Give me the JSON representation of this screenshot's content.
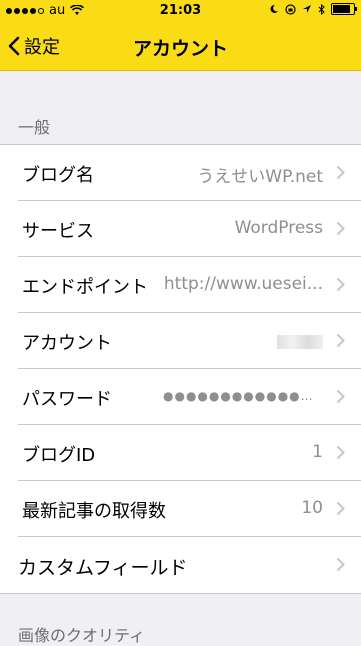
{
  "status": {
    "carrier": "au",
    "time": "21:03"
  },
  "nav": {
    "back_label": "設定",
    "title": "アカウント"
  },
  "section_general": "一般",
  "rows": [
    {
      "label": "ブログ名",
      "value": "うえせいWP.net"
    },
    {
      "label": "サービス",
      "value": "WordPress"
    },
    {
      "label": "エンドポイント",
      "value": "http://www.uesei..."
    },
    {
      "label": "アカウント",
      "value": ""
    },
    {
      "label": "パスワード",
      "value": "●●●●●●●●●●●●●●●..."
    },
    {
      "label": "ブログID",
      "value": "1"
    },
    {
      "label": "最新記事の取得数",
      "value": "10"
    },
    {
      "label": "カスタムフィールド",
      "value": ""
    }
  ],
  "section_image_quality": "画像のクオリティ",
  "colors": {
    "bar": "#f9dc16",
    "background": "#efeff4",
    "secondary_text": "#8e8e93"
  }
}
